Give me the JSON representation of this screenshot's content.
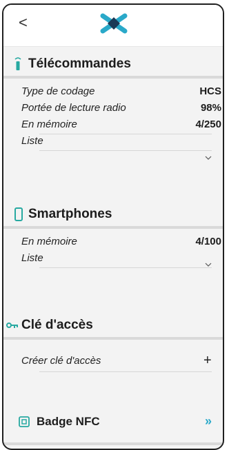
{
  "header": {
    "back_glyph": "<"
  },
  "telecommandes": {
    "title": "Télécommandes",
    "rows": [
      {
        "label": "Type de codage",
        "value": "HCS"
      },
      {
        "label": "Portée de lecture radio",
        "value": "98%"
      },
      {
        "label": "En mémoire",
        "value": "4/250"
      }
    ],
    "list_label": "Liste"
  },
  "smartphones": {
    "title": "Smartphones",
    "rows": [
      {
        "label": "En mémoire",
        "value": "4/100"
      }
    ],
    "list_label": "Liste"
  },
  "cle_acces": {
    "title": "Clé d'accès",
    "create_label": "Créer clé d'accès",
    "add_glyph": "+"
  },
  "badge_nfc": {
    "title": "Badge NFC",
    "next_glyph": "»"
  },
  "colors": {
    "accent": "#2aa9c9",
    "logo_dark": "#1a3a57"
  }
}
